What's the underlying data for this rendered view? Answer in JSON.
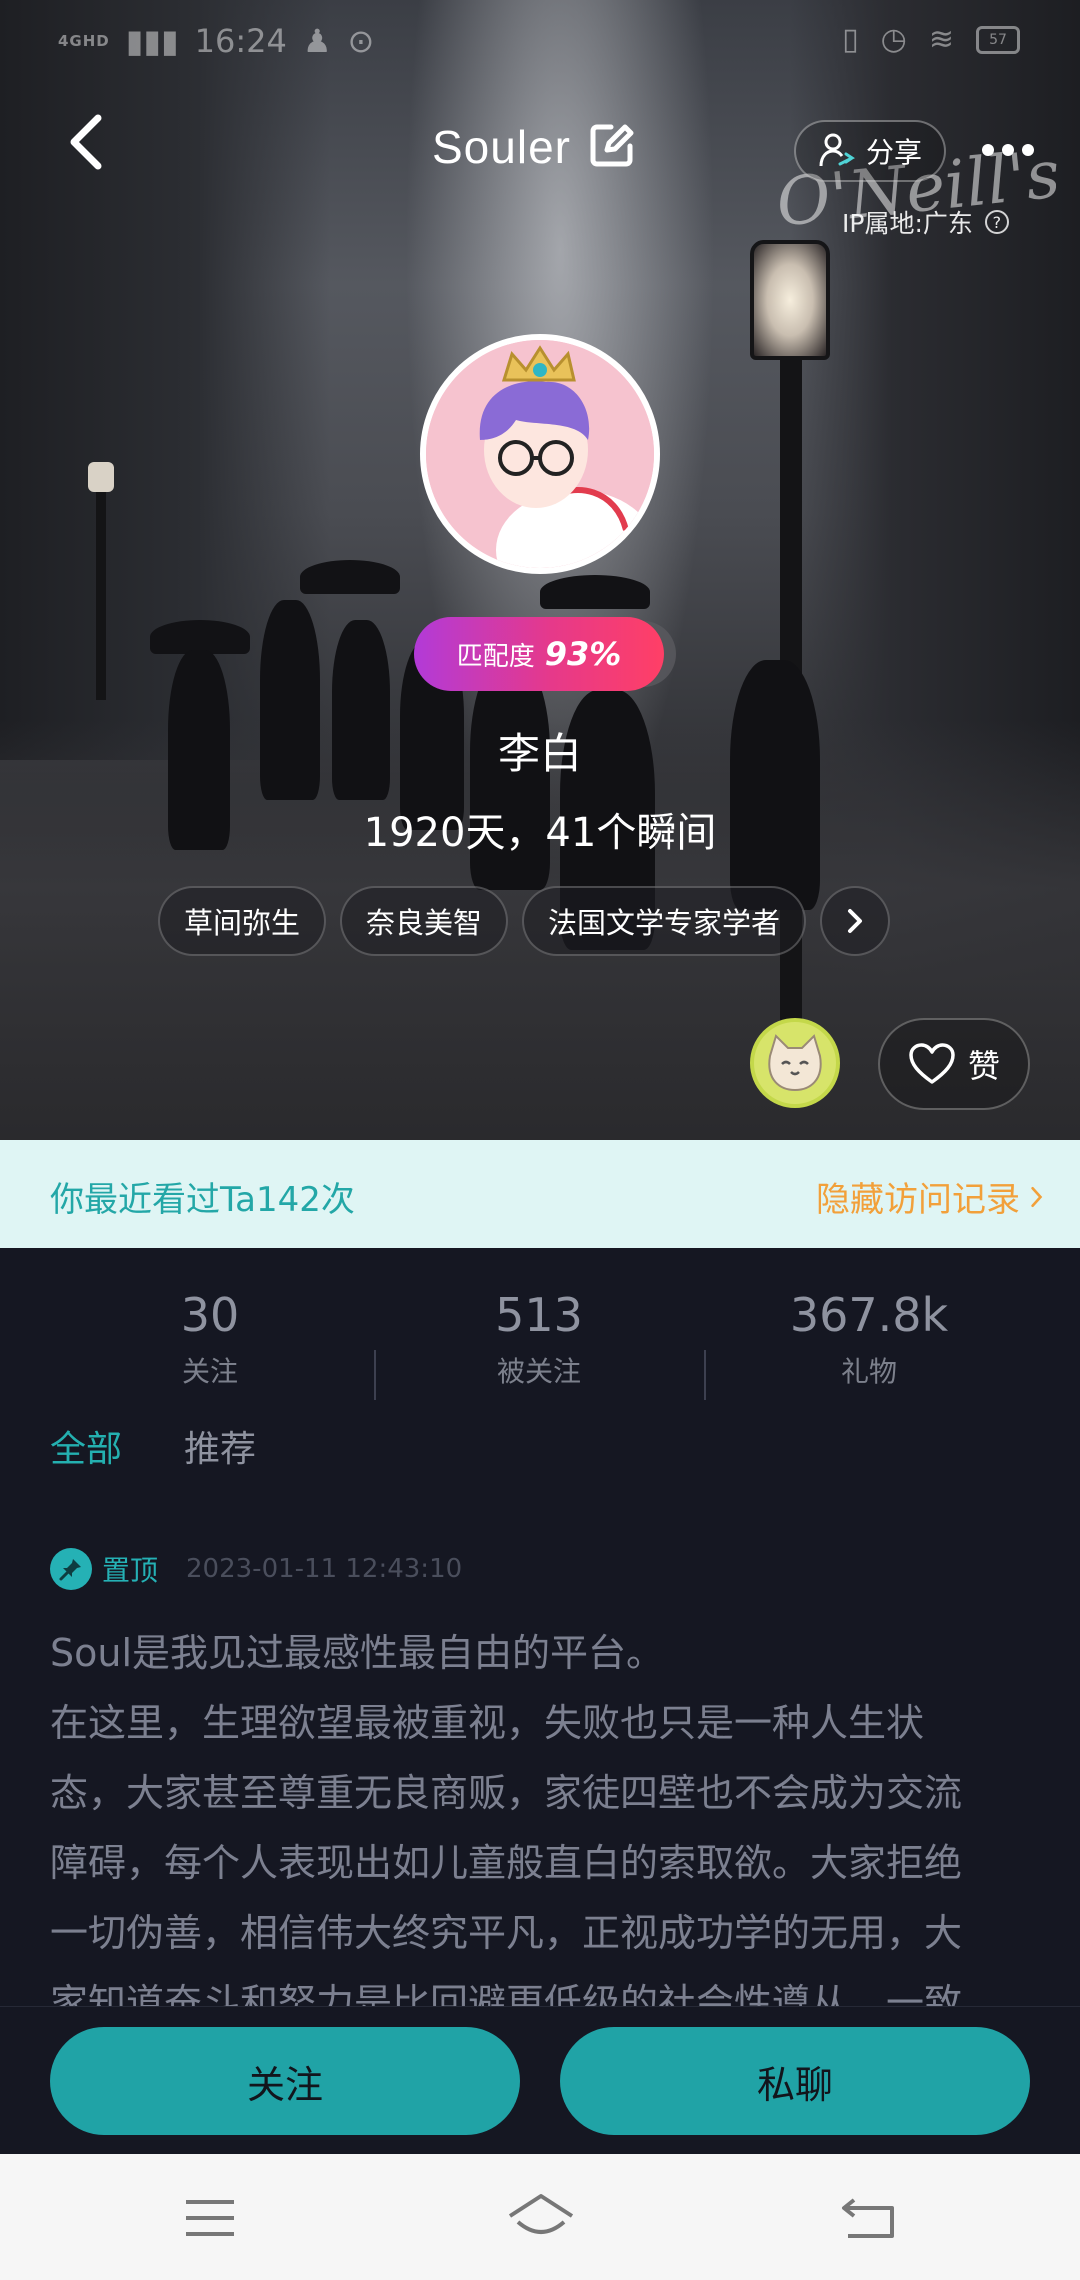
{
  "status_bar": {
    "network": "4GHD",
    "time": "16:24",
    "battery": "57"
  },
  "header": {
    "title": "Souler",
    "share_label": "分享",
    "ip_location": "IP属地:广东"
  },
  "profile": {
    "match_label": "匹配度",
    "match_value": "93%",
    "name": "李白",
    "days_line": "1920天，41个瞬间",
    "tags": [
      "草间弥生",
      "奈良美智",
      "法国文学专家学者"
    ],
    "like_label": "赞",
    "background_sign": "O'Neill's"
  },
  "visit_banner": {
    "left_text": "你最近看过Ta142次",
    "right_text": "隐藏访问记录"
  },
  "stats": [
    {
      "value": "30",
      "label": "关注"
    },
    {
      "value": "513",
      "label": "被关注"
    },
    {
      "value": "367.8k",
      "label": "礼物"
    }
  ],
  "tabs": [
    {
      "label": "全部",
      "active": true
    },
    {
      "label": "推荐",
      "active": false
    }
  ],
  "post": {
    "pin_label": "置顶",
    "date": "2023-01-11 12:43:10",
    "lines": [
      "Soul是我见过最感性最自由的平台。",
      "在这里，生理欲望最被重视，失败也只是一种人生状",
      "态，大家甚至尊重无良商贩，家徒四壁也不会成为交流",
      "障碍，每个人表现出如儿童般直白的索取欲。大家拒绝",
      "一切伪善，相信伟大终究平凡，正视成功学的无用，大",
      "家知道奋斗和努力是比回避更低级的社会性遵从，一致"
    ]
  },
  "actions": {
    "follow_label": "关注",
    "chat_label": "私聊"
  },
  "colors": {
    "accent": "#20a3a6",
    "visit_bg": "#dff5f4",
    "visit_link": "#f2a03a",
    "match_gradient_start": "#b23ad8",
    "match_gradient_end": "#ff3f66"
  }
}
